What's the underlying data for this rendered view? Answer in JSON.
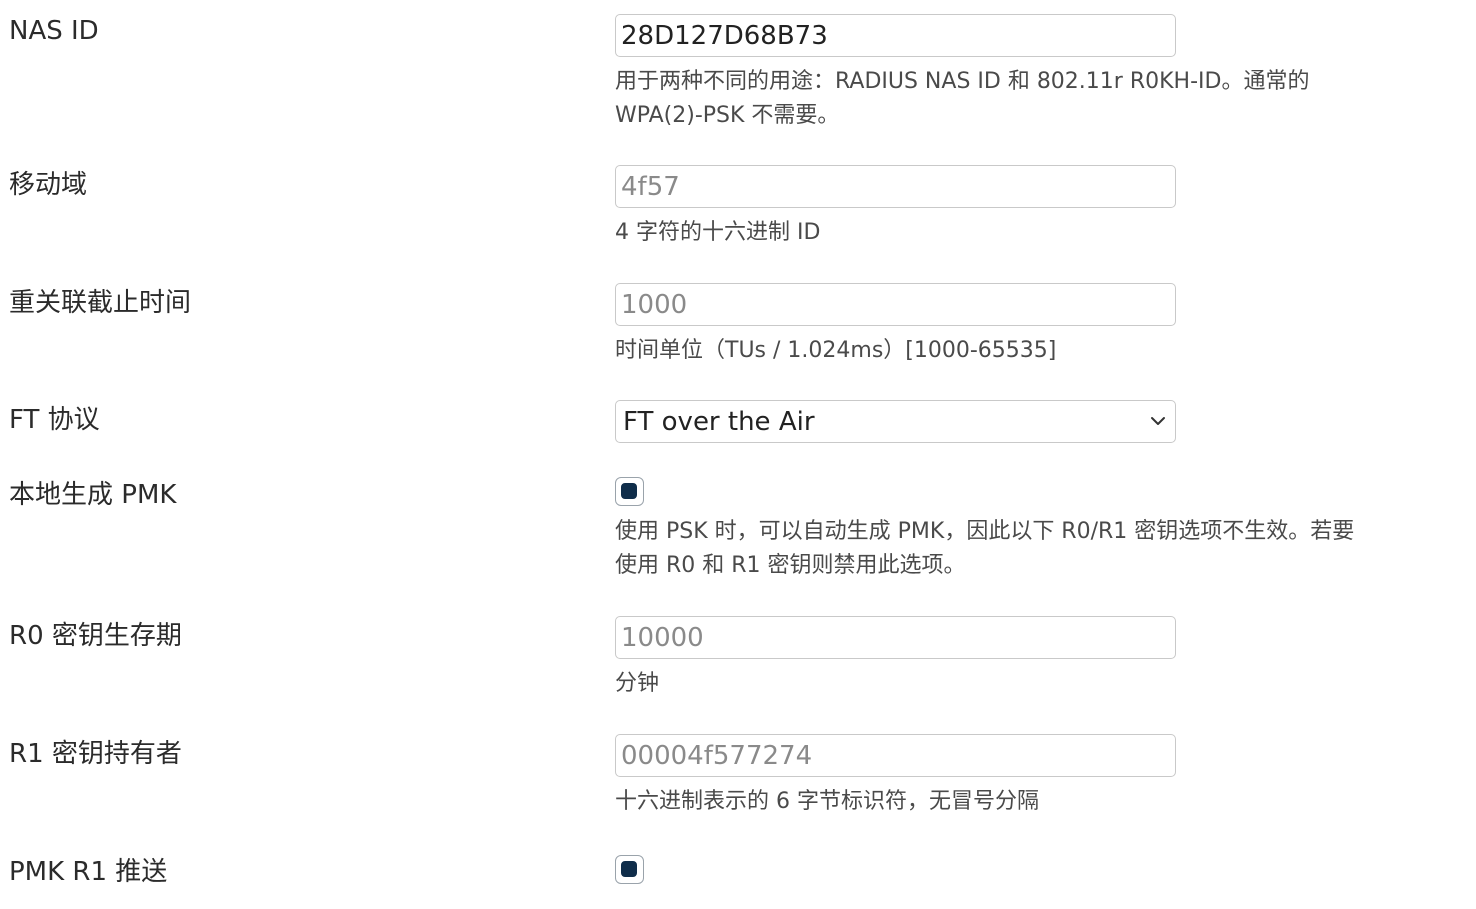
{
  "nas_id": {
    "label": "NAS ID",
    "value": "28D127D68B73",
    "help_line1": "用于两种不同的用途：RADIUS NAS ID 和 802.11r R0KH-ID。通常的",
    "help_line2": "WPA(2)-PSK 不需要。"
  },
  "mobility_domain": {
    "label": "移动域",
    "placeholder": "4f57",
    "help": "4 字符的十六进制 ID"
  },
  "reassoc_deadline": {
    "label": "重关联截止时间",
    "placeholder": "1000",
    "help": "时间单位（TUs / 1.024ms）[1000-65535]"
  },
  "ft_protocol": {
    "label": "FT 协议",
    "selected": "FT over the Air"
  },
  "local_pmk": {
    "label": "本地生成 PMK",
    "checked": true,
    "help_line1": "使用 PSK 时，可以自动生成 PMK，因此以下 R0/R1 密钥选项不生效。若要",
    "help_line2": "使用 R0 和 R1 密钥则禁用此选项。"
  },
  "r0_lifetime": {
    "label": "R0 密钥生存期",
    "placeholder": "10000",
    "help": "分钟"
  },
  "r1_key_holder": {
    "label": "R1 密钥持有者",
    "placeholder": "00004f577274",
    "help": "十六进制表示的 6 字节标识符，无冒号分隔"
  },
  "pmk_r1_push": {
    "label": "PMK R1 推送",
    "checked": true
  },
  "colors": {
    "checkbox_fill": "#0f2d4a",
    "input_border": "#c9c9c9"
  }
}
